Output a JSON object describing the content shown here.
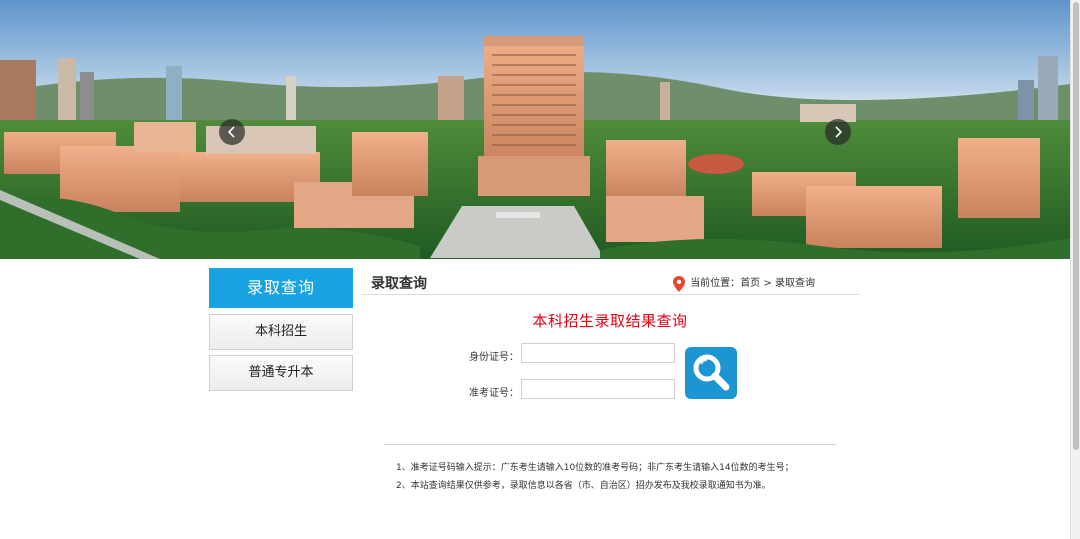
{
  "sidebar": {
    "title": "录取查询",
    "items": [
      {
        "label": "本科招生"
      },
      {
        "label": "普通专升本"
      }
    ]
  },
  "main": {
    "title": "录取查询",
    "breadcrumb": {
      "prefix": "当前位置：",
      "home": "首页",
      "separator": ">",
      "current": "录取查询"
    },
    "result_title": "本科招生录取结果查询",
    "form": {
      "id_label": "身份证号：",
      "id_value": "",
      "exam_label": "准考证号：",
      "exam_value": ""
    },
    "notes": [
      "1、准考证号码输入提示：广东考生请输入10位数的准考号码；非广东考生请输入14位数的考生号；",
      "2、本站查询结果仅供参考，录取信息以各省（市、自治区）招办发布及我校录取通知书为准。"
    ]
  },
  "colors": {
    "accent": "#1aa3e3",
    "result_title": "#e60012",
    "search_button": "#1b96d3",
    "pin": "#e8442e"
  },
  "icons": {
    "prev": "chevron-left-icon",
    "next": "chevron-right-icon",
    "location": "map-pin-icon",
    "search": "magnifier-icon"
  }
}
